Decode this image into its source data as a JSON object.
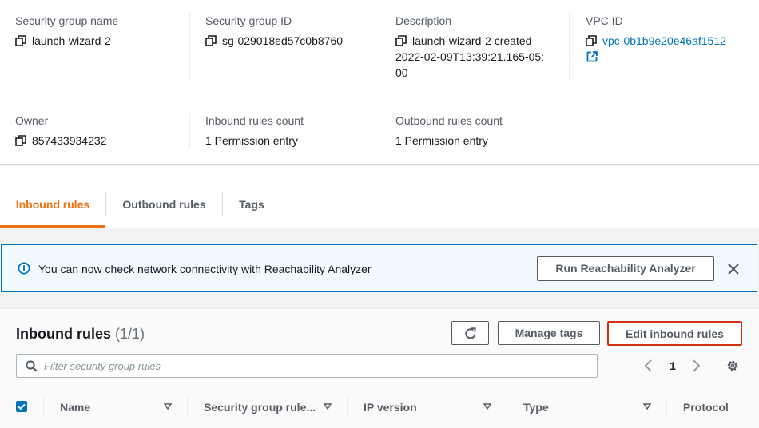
{
  "details": {
    "sg_name": {
      "label": "Security group name",
      "value": "launch-wizard-2"
    },
    "sg_id": {
      "label": "Security group ID",
      "value": "sg-029018ed57c0b8760"
    },
    "description": {
      "label": "Description",
      "line1": "launch-wizard-2 created",
      "line2": "2022-02-09T13:39:21.165-05:",
      "line3": "00"
    },
    "vpc_id": {
      "label": "VPC ID",
      "value": "vpc-0b1b9e20e46af1512"
    },
    "owner": {
      "label": "Owner",
      "value": "857433934232"
    },
    "inbound_count": {
      "label": "Inbound rules count",
      "value": "1 Permission entry"
    },
    "outbound_count": {
      "label": "Outbound rules count",
      "value": "1 Permission entry"
    }
  },
  "tabs": [
    {
      "label": "Inbound rules",
      "active": true
    },
    {
      "label": "Outbound rules",
      "active": false
    },
    {
      "label": "Tags",
      "active": false
    }
  ],
  "alert": {
    "message": "You can now check network connectivity with Reachability Analyzer",
    "button": "Run Reachability Analyzer"
  },
  "panel": {
    "title": "Inbound rules",
    "count": "(1/1)",
    "manage_tags": "Manage tags",
    "edit_rules": "Edit inbound rules",
    "search_placeholder": "Filter security group rules",
    "page": "1"
  },
  "table": {
    "columns": [
      "Name",
      "Security group rule...",
      "IP version",
      "Type",
      "Protocol"
    ]
  },
  "colors": {
    "accent": "#ec7211",
    "link": "#0073bb",
    "highlight": "#d13212"
  }
}
